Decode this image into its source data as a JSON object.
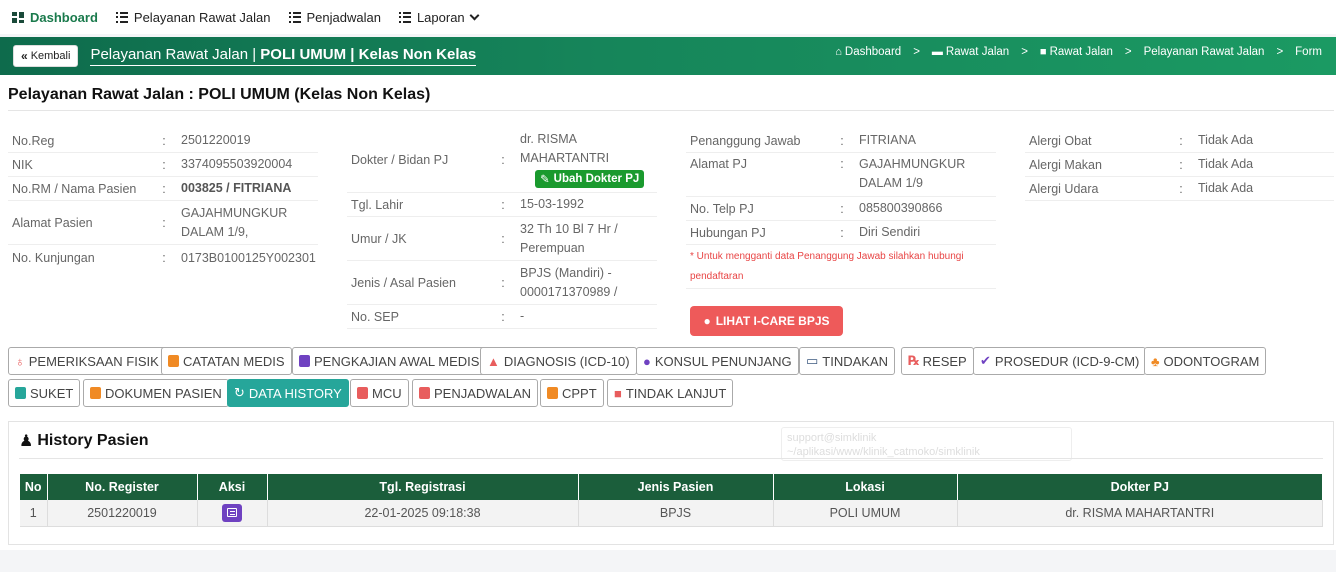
{
  "topnav": {
    "items": [
      {
        "label": "Dashboard",
        "icon": "grid-icon",
        "active": true
      },
      {
        "label": "Pelayanan Rawat Jalan",
        "icon": "list-icon"
      },
      {
        "label": "Penjadwalan",
        "icon": "list-icon"
      },
      {
        "label": "Laporan",
        "icon": "list-icon"
      }
    ]
  },
  "header": {
    "back_label": "Kembali",
    "title_prefix": "Pelayanan Rawat Jalan | ",
    "title_bold": "POLI UMUM | Kelas Non Kelas",
    "breadcrumb": [
      "Dashboard",
      "Rawat Jalan",
      "Rawat Jalan",
      "Pelayanan Rawat Jalan",
      "Form"
    ],
    "breadcrumb_sep": ">"
  },
  "page": {
    "title": "Pelayanan Rawat Jalan : POLI UMUM (Kelas Non Kelas)"
  },
  "colon": ":",
  "patient": {
    "no_reg_label": "No.Reg",
    "no_reg": "2501220019",
    "nik_label": "NIK",
    "nik": "3374095503920004",
    "norm_label": "No.RM / Nama Pasien",
    "norm": "003825 / FITRIANA",
    "alamat_label": "Alamat Pasien",
    "alamat": "GAJAHMUNGKUR DALAM 1/9,",
    "kunjungan_label": "No. Kunjungan",
    "kunjungan": "0173B0100125Y002301"
  },
  "doctor": {
    "dokter_label": "Dokter / Bidan PJ",
    "dokter": "dr. RISMA MAHARTANTRI",
    "ubah_label": "Ubah Dokter PJ",
    "lahir_label": "Tgl. Lahir",
    "lahir": "15-03-1992",
    "umur_label": "Umur / JK",
    "umur": "32 Th 10 Bl 7 Hr / Perempuan",
    "jenis_label": "Jenis / Asal Pasien",
    "jenis": "BPJS (Mandiri) - 0000171370989 /",
    "sep_label": "No. SEP",
    "sep": "-"
  },
  "pj": {
    "nama_label": "Penanggung Jawab",
    "nama": "FITRIANA",
    "alamat_label": "Alamat PJ",
    "alamat": "GAJAHMUNGKUR DALAM 1/9",
    "telp_label": "No. Telp PJ",
    "telp": "085800390866",
    "hub_label": "Hubungan PJ",
    "hub": "Diri Sendiri",
    "note": "* Untuk mengganti data Penanggung Jawab silahkan hubungi pendaftaran",
    "icare_label": "LIHAT I-CARE BPJS"
  },
  "alergi": {
    "obat_label": "Alergi Obat",
    "obat": "Tidak Ada",
    "makan_label": "Alergi Makan",
    "makan": "Tidak Ada",
    "udara_label": "Alergi Udara",
    "udara": "Tidak Ada"
  },
  "tabs": [
    {
      "label": "PEMERIKSAAN FISIK",
      "color": "#e85d5d"
    },
    {
      "label": "CATATAN MEDIS",
      "color": "#f08a24"
    },
    {
      "label": "PENGKAJIAN AWAL MEDIS",
      "color": "#6f42c1"
    },
    {
      "label": "DIAGNOSIS (ICD-10)",
      "color": "#e85d5d"
    },
    {
      "label": "KONSUL PENUNJANG",
      "color": "#6f42c1"
    },
    {
      "label": "TINDAKAN",
      "color": "#3d5a80"
    },
    {
      "label": "RESEP",
      "color": "#e85d5d"
    },
    {
      "label": "PROSEDUR (ICD-9-CM)",
      "color": "#6f42c1"
    },
    {
      "label": "ODONTOGRAM",
      "color": "#f08a24"
    },
    {
      "label": "SUKET",
      "color": "#26a69a"
    },
    {
      "label": "DOKUMEN PASIEN",
      "color": "#f08a24"
    },
    {
      "label": "DATA HISTORY",
      "color": "#ffffff",
      "active": true
    },
    {
      "label": "MCU",
      "color": "#e85d5d"
    },
    {
      "label": "PENJADWALAN",
      "color": "#e85d5d"
    },
    {
      "label": "CPPT",
      "color": "#f08a24"
    },
    {
      "label": "TINDAK LANJUT",
      "color": "#e85d5d"
    }
  ],
  "history": {
    "title": "History Pasien",
    "ghost_text": "support@simklinik ~/aplikasi/www/klinik_catmoko/simklinik",
    "columns": [
      "No",
      "No. Register",
      "Aksi",
      "Tgl. Registrasi",
      "Jenis Pasien",
      "Lokasi",
      "Dokter PJ"
    ],
    "rows": [
      {
        "no": "1",
        "register": "2501220019",
        "tgl": "22-01-2025 09:18:38",
        "jenis": "BPJS",
        "lokasi": "POLI UMUM",
        "dokter": "dr. RISMA MAHARTANTRI"
      }
    ]
  }
}
